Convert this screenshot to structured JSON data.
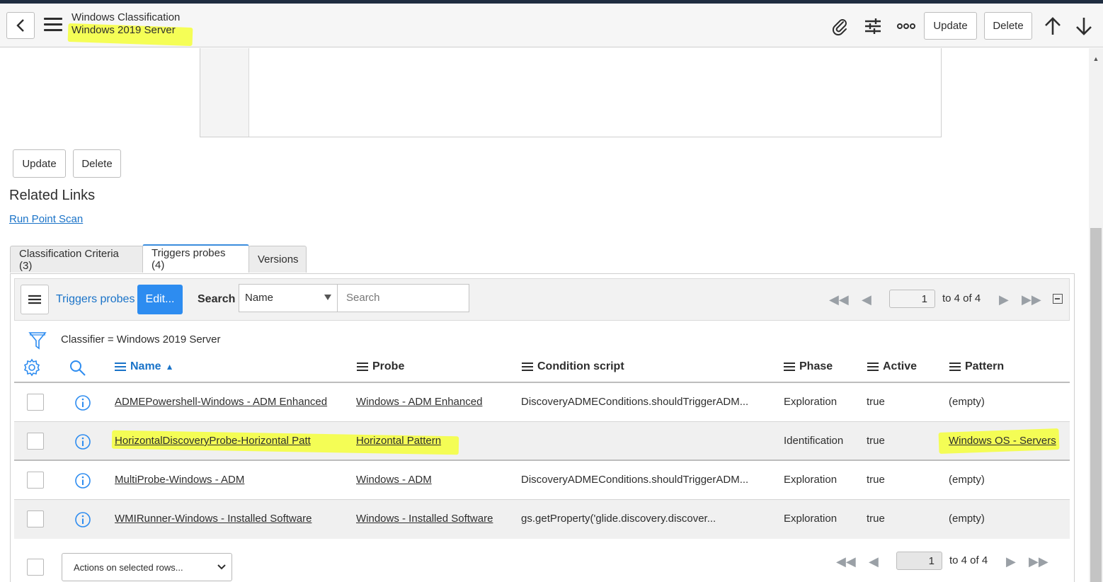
{
  "header": {
    "title": "Windows Classification",
    "subtitle": "Windows 2019 Server",
    "update_label": "Update",
    "delete_label": "Delete",
    "icons": [
      "paperclip-icon",
      "settings-sliders-icon",
      "more-icon",
      "arrow-up-icon",
      "arrow-down-icon"
    ]
  },
  "form_buttons": {
    "update_label": "Update",
    "delete_label": "Delete"
  },
  "related_links": {
    "heading": "Related Links",
    "run_point_scan": "Run Point Scan"
  },
  "tabs": [
    {
      "label": "Classification Criteria (3)",
      "active": false
    },
    {
      "label": "Triggers probes (4)",
      "active": true
    },
    {
      "label": "Versions",
      "active": false
    }
  ],
  "list": {
    "title": "Triggers probes",
    "edit_label": "Edit...",
    "search_label": "Search",
    "search_field": "Name",
    "search_placeholder": "Search",
    "page": "1",
    "page_range": "to 4 of 4",
    "filter": "Classifier = Windows 2019 Server",
    "columns": [
      "Name",
      "Probe",
      "Condition script",
      "Phase",
      "Active",
      "Pattern"
    ],
    "rows": [
      {
        "name": "ADMEPowershell-Windows - ADM Enhanced",
        "probe": "Windows - ADM Enhanced",
        "condition": "DiscoveryADMEConditions.shouldTriggerADM...",
        "phase": "Exploration",
        "active": "true",
        "pattern": "(empty)"
      },
      {
        "name": "HorizontalDiscoveryProbe-Horizontal Patt",
        "probe": "Horizontal Pattern",
        "condition": "",
        "phase": "Identification",
        "active": "true",
        "pattern": "Windows OS - Servers"
      },
      {
        "name": "MultiProbe-Windows - ADM",
        "probe": "Windows - ADM",
        "condition": "DiscoveryADMEConditions.shouldTriggerADM...",
        "phase": "Exploration",
        "active": "true",
        "pattern": "(empty)"
      },
      {
        "name": "WMIRunner-Windows - Installed Software",
        "probe": "Windows - Installed Software",
        "condition": "gs.getProperty('glide.discovery.discover...",
        "phase": "Exploration",
        "active": "true",
        "pattern": "(empty)"
      }
    ],
    "actions_label": "Actions on selected rows..."
  },
  "colors": {
    "accent": "#2d8cf0",
    "link": "#1a73c8",
    "highlight": "#f4ff3a",
    "top_strip": "#1f2d40"
  }
}
